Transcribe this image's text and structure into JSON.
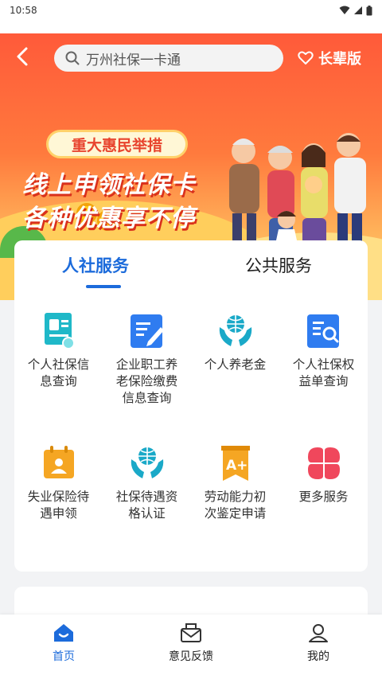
{
  "status_bar": {
    "time": "10:58"
  },
  "header": {
    "search_placeholder": "万州社保一卡通",
    "elder_mode_label": "长辈版"
  },
  "banner": {
    "badge": "重大惠民举措",
    "line1": "线上申领社保卡",
    "line2": "各种优惠享不停"
  },
  "service_tabs": [
    {
      "label": "人社服务",
      "active": true
    },
    {
      "label": "公共服务",
      "active": false
    }
  ],
  "services": [
    {
      "label": "个人社保信息查询",
      "icon": "id-card-icon",
      "color": "#1fb8c8"
    },
    {
      "label": "企业职工养老保险缴费信息查询",
      "icon": "edit-document-icon",
      "color": "#2f7cf0"
    },
    {
      "label": "个人养老金",
      "icon": "globe-hands-icon",
      "color": "#1aa9c8"
    },
    {
      "label": "个人社保权益单查询",
      "icon": "document-search-icon",
      "color": "#2f7cf0"
    },
    {
      "label": "失业保险待遇申领",
      "icon": "calendar-person-icon",
      "color": "#f5a623"
    },
    {
      "label": "社保待遇资格认证",
      "icon": "globe-hands-icon",
      "color": "#1aa9c8"
    },
    {
      "label": "劳动能力初次鉴定申请",
      "icon": "grade-a-plus-icon",
      "color": "#f5a623"
    },
    {
      "label": "更多服务",
      "icon": "four-petal-icon",
      "color": "#f0475c"
    }
  ],
  "tabbar": [
    {
      "label": "首页",
      "icon": "home-icon",
      "active": true
    },
    {
      "label": "意见反馈",
      "icon": "mail-icon",
      "active": false
    },
    {
      "label": "我的",
      "icon": "user-icon",
      "active": false
    }
  ]
}
